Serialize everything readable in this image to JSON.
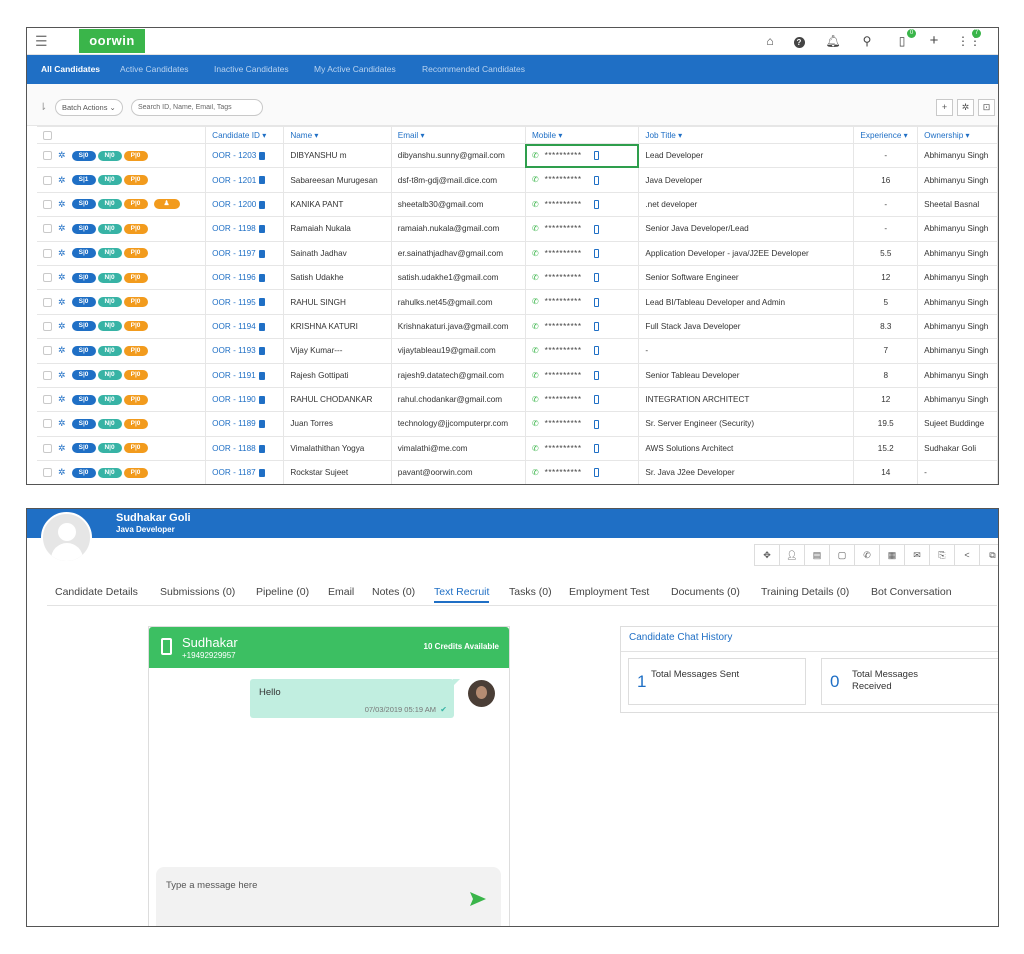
{
  "app": {
    "logo_text": "oorwin",
    "brand_color": "#1f6fc5",
    "accent_green": "#3ab54a"
  },
  "topbar": {
    "icons": [
      "home-icon",
      "help-icon",
      "bell-icon",
      "search-icon",
      "mobile-icon",
      "plus-icon",
      "grid-icon"
    ],
    "mobile_badge": "0",
    "grid_badge": "7"
  },
  "tabs": [
    "All Candidates",
    "Active Candidates",
    "Inactive Candidates",
    "My Active Candidates",
    "Recommended Candidates"
  ],
  "toolbar": {
    "batch_actions": "Batch Actions ⌄",
    "search_placeholder": "Search ID, Name, Email, Tags"
  },
  "table": {
    "headers": [
      "Candidate ID ▾",
      "Name ▾",
      "Email ▾",
      "Mobile ▾",
      "Job Title ▾",
      "Experience ▾",
      "Ownership ▾"
    ],
    "rows": [
      {
        "s": "S|0",
        "n": "N|0",
        "p": "P|0",
        "id": "OOR - 1203",
        "name": "DIBYANSHU m",
        "email": "dibyanshu.sunny@gmail.com",
        "mobile": "**********",
        "title": "Lead Developer",
        "exp": "-",
        "owner": "Abhimanyu Singh"
      },
      {
        "s": "S|1",
        "n": "N|0",
        "p": "P|0",
        "id": "OOR - 1201",
        "name": "Sabareesan Murugesan",
        "email": "dsf-t8m-gdj@mail.dice.com",
        "mobile": "**********",
        "title": "Java Developer",
        "exp": "16",
        "owner": "Abhimanyu Singh"
      },
      {
        "s": "S|0",
        "n": "N|0",
        "p": "P|0",
        "u": "♟",
        "id": "OOR - 1200",
        "name": "KANIKA PANT",
        "email": "sheetalb30@gmail.com",
        "mobile": "**********",
        "title": ".net developer",
        "exp": "-",
        "owner": "Sheetal Basnal"
      },
      {
        "s": "S|0",
        "n": "N|0",
        "p": "P|0",
        "id": "OOR - 1198",
        "name": "Ramaiah Nukala",
        "email": "ramaiah.nukala@gmail.com",
        "mobile": "**********",
        "title": "Senior Java Developer/Lead",
        "exp": "-",
        "owner": "Abhimanyu Singh"
      },
      {
        "s": "S|0",
        "n": "N|0",
        "p": "P|0",
        "id": "OOR - 1197",
        "name": "Sainath Jadhav",
        "email": "er.sainathjadhav@gmail.com",
        "mobile": "**********",
        "title": "Application Developer - java/J2EE Developer",
        "exp": "5.5",
        "owner": "Abhimanyu Singh"
      },
      {
        "s": "S|0",
        "n": "N|0",
        "p": "P|0",
        "id": "OOR - 1196",
        "name": "Satish Udakhe",
        "email": "satish.udakhe1@gmail.com",
        "mobile": "**********",
        "title": "Senior Software Engineer",
        "exp": "12",
        "owner": "Abhimanyu Singh"
      },
      {
        "s": "S|0",
        "n": "N|0",
        "p": "P|0",
        "id": "OOR - 1195",
        "name": "RAHUL SINGH",
        "email": "rahulks.net45@gmail.com",
        "mobile": "**********",
        "title": "Lead BI/Tableau Developer and Admin",
        "exp": "5",
        "owner": "Abhimanyu Singh"
      },
      {
        "s": "S|0",
        "n": "N|0",
        "p": "P|0",
        "id": "OOR - 1194",
        "name": "KRISHNA KATURI",
        "email": "Krishnakaturi.java@gmail.com",
        "mobile": "**********",
        "title": "Full Stack Java Developer",
        "exp": "8.3",
        "owner": "Abhimanyu Singh"
      },
      {
        "s": "S|0",
        "n": "N|0",
        "p": "P|0",
        "id": "OOR - 1193",
        "name": "Vijay Kumar---",
        "email": "vijaytableau19@gmail.com",
        "mobile": "**********",
        "title": "-",
        "exp": "7",
        "owner": "Abhimanyu Singh"
      },
      {
        "s": "S|0",
        "n": "N|0",
        "p": "P|0",
        "id": "OOR - 1191",
        "name": "Rajesh Gottipati",
        "email": "rajesh9.datatech@gmail.com",
        "mobile": "**********",
        "title": "Senior Tableau Developer",
        "exp": "8",
        "owner": "Abhimanyu Singh"
      },
      {
        "s": "S|0",
        "n": "N|0",
        "p": "P|0",
        "id": "OOR - 1190",
        "name": "RAHUL CHODANKAR",
        "email": "rahul.chodankar@gmail.com",
        "mobile": "**********",
        "title": "INTEGRATION ARCHITECT",
        "exp": "12",
        "owner": "Abhimanyu Singh"
      },
      {
        "s": "S|0",
        "n": "N|0",
        "p": "P|0",
        "id": "OOR - 1189",
        "name": "Juan Torres",
        "email": "technology@jjcomputerpr.com",
        "mobile": "**********",
        "title": "Sr. Server Engineer (Security)",
        "exp": "19.5",
        "owner": "Sujeet Buddinge"
      },
      {
        "s": "S|0",
        "n": "N|0",
        "p": "P|0",
        "id": "OOR - 1188",
        "name": "Vimalathithan Yogya",
        "email": "vimalathi@me.com",
        "mobile": "**********",
        "title": "AWS Solutions Architect",
        "exp": "15.2",
        "owner": "Sudhakar Goli"
      },
      {
        "s": "S|0",
        "n": "N|0",
        "p": "P|0",
        "id": "OOR - 1187",
        "name": "Rockstar Sujeet",
        "email": "pavant@oorwin.com",
        "mobile": "**********",
        "title": "Sr. Java J2ee Developer",
        "exp": "14",
        "owner": "-"
      }
    ]
  },
  "candidate": {
    "name": "Sudhakar Goli",
    "role": "Java Developer"
  },
  "action_icons": [
    "move-icon",
    "assign-user-icon",
    "resume-icon",
    "document-icon",
    "call-icon",
    "note-icon",
    "mail-icon",
    "export-icon",
    "share-icon",
    "copy-icon"
  ],
  "detail_tabs": [
    "Candidate Details",
    "Submissions (0)",
    "Pipeline (0)",
    "Email",
    "Notes (0)",
    "Text Recruit",
    "Tasks (0)",
    "Employment Test",
    "Documents (0)",
    "Training Details (0)",
    "Bot Conversation"
  ],
  "chat": {
    "name": "Sudhakar",
    "phone": "+19492929957",
    "credits": "10 Credits Available",
    "message": "Hello",
    "time": "07/03/2019 05:19 AM",
    "input_placeholder": "Type a message here"
  },
  "history": {
    "title": "Candidate Chat History",
    "sent_count": "1",
    "sent_label": "Total Messages Sent",
    "received_count": "0",
    "received_label": "Total Messages Received"
  }
}
